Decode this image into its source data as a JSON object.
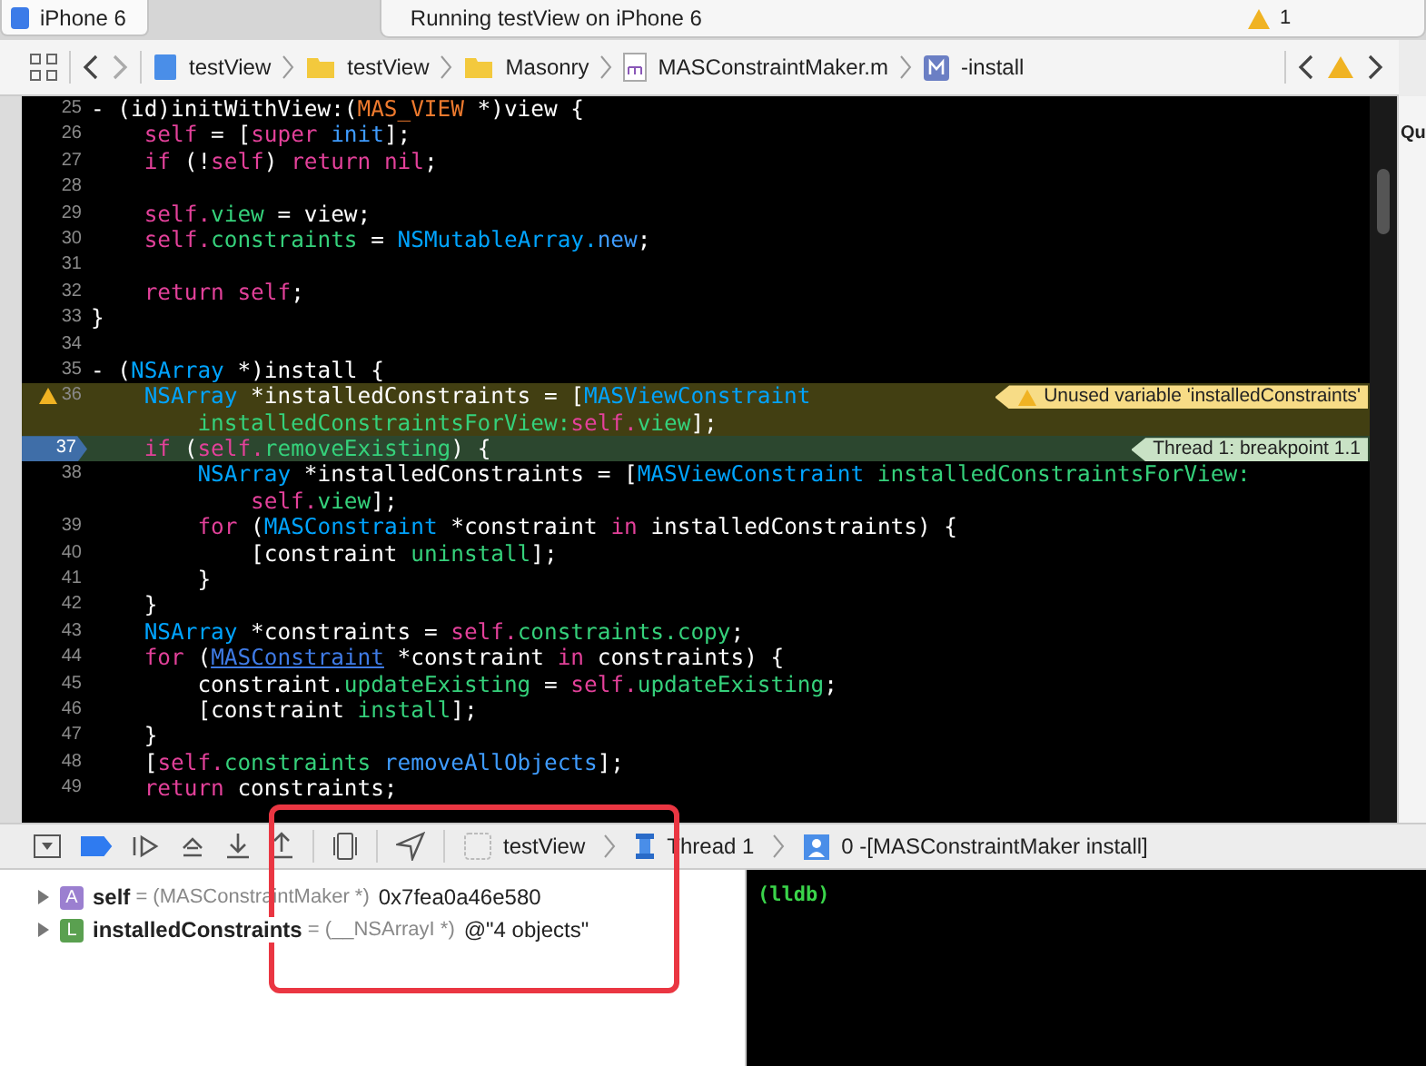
{
  "toolbar": {
    "scheme": "iPhone 6",
    "activity": "Running testView on iPhone 6",
    "warning_count": "1"
  },
  "jump_bar": {
    "items": [
      {
        "label": "testView",
        "kind": "project"
      },
      {
        "label": "testView",
        "kind": "folder"
      },
      {
        "label": "Masonry",
        "kind": "folder"
      },
      {
        "label": "MASConstraintMaker.m",
        "kind": "file"
      },
      {
        "label": "-install",
        "kind": "method"
      }
    ]
  },
  "editor": {
    "lines": [
      {
        "number": "25",
        "kind": "plain",
        "tokens": [
          {
            "text": "- (id)initWithView:(",
            "kind": "plain"
          },
          {
            "text": "MAS_VIEW",
            "kind": "macro"
          },
          {
            "text": " *)view {",
            "kind": "plain"
          }
        ]
      },
      {
        "number": "26",
        "kind": "plain",
        "tokens": [
          {
            "text": "    self",
            "kind": "kw"
          },
          {
            "text": " = [",
            "kind": "plain"
          },
          {
            "text": "super",
            "kind": "kw"
          },
          {
            "text": " init",
            "kind": "method"
          },
          {
            "text": "];",
            "kind": "plain"
          }
        ]
      },
      {
        "number": "27",
        "kind": "plain",
        "tokens": [
          {
            "text": "    if",
            "kind": "kw"
          },
          {
            "text": " (!",
            "kind": "plain"
          },
          {
            "text": "self",
            "kind": "kw"
          },
          {
            "text": ") ",
            "kind": "plain"
          },
          {
            "text": "return nil",
            "kind": "kw"
          },
          {
            "text": ";",
            "kind": "plain"
          }
        ]
      },
      {
        "number": "28",
        "kind": "plain"
      },
      {
        "number": "29",
        "kind": "plain",
        "tokens": [
          {
            "text": "    self.",
            "kind": "kw"
          },
          {
            "text": "view",
            "kind": "prop"
          },
          {
            "text": " = view;",
            "kind": "plain"
          }
        ]
      },
      {
        "number": "30",
        "kind": "plain",
        "tokens": [
          {
            "text": "    self.",
            "kind": "kw"
          },
          {
            "text": "constraints",
            "kind": "prop"
          },
          {
            "text": " = ",
            "kind": "plain"
          },
          {
            "text": "NSMutableArray.",
            "kind": "type"
          },
          {
            "text": "new",
            "kind": "method"
          },
          {
            "text": ";",
            "kind": "plain"
          }
        ]
      },
      {
        "number": "31",
        "kind": "plain"
      },
      {
        "number": "32",
        "kind": "plain",
        "tokens": [
          {
            "text": "    return self",
            "kind": "kw"
          },
          {
            "text": ";",
            "kind": "plain"
          }
        ]
      },
      {
        "number": "33",
        "kind": "plain",
        "tokens": [
          {
            "text": "}",
            "kind": "plain"
          }
        ]
      },
      {
        "number": "34",
        "kind": "plain"
      },
      {
        "number": "35",
        "kind": "plain",
        "tokens": [
          {
            "text": "- (",
            "kind": "plain"
          },
          {
            "text": "NSArray",
            "kind": "type"
          },
          {
            "text": " *)install {",
            "kind": "plain"
          }
        ]
      },
      {
        "number": "36",
        "kind": "warning",
        "note": "Unused variable 'installedConstraints'",
        "tokens": [
          {
            "text": "    NSArray",
            "kind": "type"
          },
          {
            "text": " *installedConstraints = [",
            "kind": "plain"
          },
          {
            "text": "MASViewConstraint",
            "kind": "type"
          }
        ],
        "wrapped": [
          {
            "text": "        installedConstraintsForView:",
            "kind": "prop"
          },
          {
            "text": "self.",
            "kind": "kw"
          },
          {
            "text": "view",
            "kind": "prop"
          },
          {
            "text": "];",
            "kind": "plain"
          }
        ]
      },
      {
        "number": "37",
        "kind": "breakpoint",
        "note": "Thread 1: breakpoint 1.1",
        "tokens": [
          {
            "text": "    if",
            "kind": "kw"
          },
          {
            "text": " (",
            "kind": "plain"
          },
          {
            "text": "self.",
            "kind": "kw"
          },
          {
            "text": "removeExisting",
            "kind": "prop"
          },
          {
            "text": ") {",
            "kind": "plain"
          }
        ]
      },
      {
        "number": "38",
        "kind": "plain",
        "tokens": [
          {
            "text": "        NSArray",
            "kind": "type"
          },
          {
            "text": " *installedConstraints = [",
            "kind": "plain"
          },
          {
            "text": "MASViewConstraint",
            "kind": "type"
          },
          {
            "text": " installedConstraintsForView:",
            "kind": "prop"
          }
        ],
        "wrapped": [
          {
            "text": "            self.",
            "kind": "kw"
          },
          {
            "text": "view",
            "kind": "prop"
          },
          {
            "text": "];",
            "kind": "plain"
          }
        ]
      },
      {
        "number": "39",
        "kind": "plain",
        "tokens": [
          {
            "text": "        for",
            "kind": "kw"
          },
          {
            "text": " (",
            "kind": "plain"
          },
          {
            "text": "MASConstraint",
            "kind": "type"
          },
          {
            "text": " *constraint ",
            "kind": "plain"
          },
          {
            "text": "in",
            "kind": "kw"
          },
          {
            "text": " installedConstraints) {",
            "kind": "plain"
          }
        ]
      },
      {
        "number": "40",
        "kind": "plain",
        "tokens": [
          {
            "text": "            [constraint ",
            "kind": "plain"
          },
          {
            "text": "uninstall",
            "kind": "prop"
          },
          {
            "text": "];",
            "kind": "plain"
          }
        ]
      },
      {
        "number": "41",
        "kind": "plain",
        "tokens": [
          {
            "text": "        }",
            "kind": "plain"
          }
        ]
      },
      {
        "number": "42",
        "kind": "plain",
        "tokens": [
          {
            "text": "    }",
            "kind": "plain"
          }
        ]
      },
      {
        "number": "43",
        "kind": "plain",
        "tokens": [
          {
            "text": "    NSArray",
            "kind": "type"
          },
          {
            "text": " *constraints = ",
            "kind": "plain"
          },
          {
            "text": "self.",
            "kind": "kw"
          },
          {
            "text": "constraints.copy",
            "kind": "prop"
          },
          {
            "text": ";",
            "kind": "plain"
          }
        ]
      },
      {
        "number": "44",
        "kind": "plain",
        "tokens": [
          {
            "text": "    for",
            "kind": "kw"
          },
          {
            "text": " (",
            "kind": "plain"
          },
          {
            "text": "MASConstraint",
            "kind": "link"
          },
          {
            "text": " *constraint ",
            "kind": "plain"
          },
          {
            "text": "in",
            "kind": "kw"
          },
          {
            "text": " constraints) {",
            "kind": "plain"
          }
        ]
      },
      {
        "number": "45",
        "kind": "plain",
        "tokens": [
          {
            "text": "        constraint.",
            "kind": "plain"
          },
          {
            "text": "updateExisting",
            "kind": "prop"
          },
          {
            "text": " = ",
            "kind": "plain"
          },
          {
            "text": "self.",
            "kind": "kw"
          },
          {
            "text": "updateExisting",
            "kind": "prop"
          },
          {
            "text": ";",
            "kind": "plain"
          }
        ]
      },
      {
        "number": "46",
        "kind": "plain",
        "tokens": [
          {
            "text": "        [constraint ",
            "kind": "plain"
          },
          {
            "text": "install",
            "kind": "prop"
          },
          {
            "text": "];",
            "kind": "plain"
          }
        ]
      },
      {
        "number": "47",
        "kind": "plain",
        "tokens": [
          {
            "text": "    }",
            "kind": "plain"
          }
        ]
      },
      {
        "number": "48",
        "kind": "plain",
        "tokens": [
          {
            "text": "    [",
            "kind": "plain"
          },
          {
            "text": "self.",
            "kind": "kw"
          },
          {
            "text": "constraints",
            "kind": "prop"
          },
          {
            "text": " removeAllObjects",
            "kind": "method"
          },
          {
            "text": "];",
            "kind": "plain"
          }
        ]
      },
      {
        "number": "49",
        "kind": "plain",
        "tokens": [
          {
            "text": "    return",
            "kind": "kw"
          },
          {
            "text": " constraints;",
            "kind": "plain"
          }
        ]
      }
    ]
  },
  "inspector": {
    "label": "Qu"
  },
  "debug_bar": {
    "breakpoints_active": true,
    "path": [
      {
        "label": "testView",
        "kind": "app"
      },
      {
        "label": "Thread 1",
        "kind": "thread"
      },
      {
        "label": "0 -[MASConstraintMaker install]",
        "kind": "frame"
      }
    ]
  },
  "variables": [
    {
      "badge": "A",
      "color": "#9b7fd0",
      "name": "self",
      "type": "= (MASConstraintMaker *)",
      "value": "0x7fea0a46e580"
    },
    {
      "badge": "L",
      "color": "#5aa050",
      "name": "installedConstraints",
      "type": "= (__NSArrayI *)",
      "value": "@\"4 objects\""
    }
  ],
  "console": {
    "prompt": "(lldb)"
  }
}
